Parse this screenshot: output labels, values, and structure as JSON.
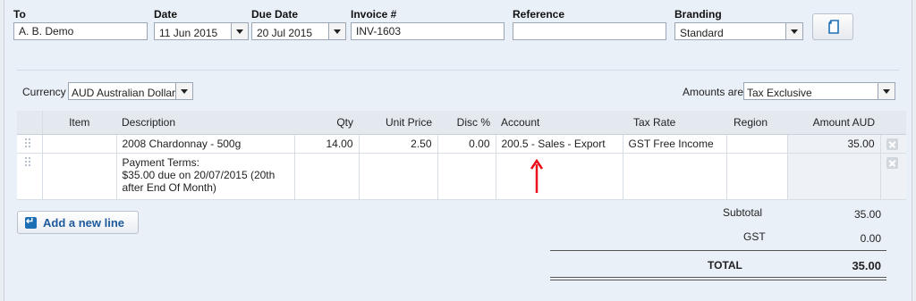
{
  "header": {
    "to": {
      "label": "To",
      "value": "A. B. Demo"
    },
    "date": {
      "label": "Date",
      "value": "11 Jun 2015"
    },
    "due_date": {
      "label": "Due Date",
      "value": "20 Jul 2015"
    },
    "invoice_no": {
      "label": "Invoice #",
      "value": "INV-1603"
    },
    "reference": {
      "label": "Reference",
      "value": ""
    },
    "branding": {
      "label": "Branding",
      "value": "Standard"
    }
  },
  "options": {
    "currency_label": "Currency",
    "currency_value": "AUD Australian Dollar",
    "amounts_label": "Amounts are",
    "amounts_value": "Tax Exclusive"
  },
  "table": {
    "columns": [
      "Item",
      "Description",
      "Qty",
      "Unit Price",
      "Disc %",
      "Account",
      "Tax Rate",
      "Region",
      "Amount AUD"
    ],
    "rows": [
      {
        "item": "",
        "description": "2008 Chardonnay - 500g",
        "qty": "14.00",
        "unit_price": "2.50",
        "disc": "0.00",
        "account": "200.5 - Sales - Export",
        "tax_rate": "GST Free Income",
        "region": "",
        "amount": "35.00"
      },
      {
        "item": "",
        "description_lines": [
          "Payment Terms:",
          "$35.00 due on 20/07/2015 (20th",
          "after End Of Month)"
        ],
        "qty": "",
        "unit_price": "",
        "disc": "",
        "account": "",
        "tax_rate": "",
        "region": "",
        "amount": ""
      }
    ]
  },
  "add_line_label": "Add a new line",
  "totals": {
    "subtotal_label": "Subtotal",
    "subtotal": "35.00",
    "gst_label": "GST",
    "gst": "0.00",
    "total_label": "TOTAL",
    "total": "35.00"
  },
  "annotation": {
    "type": "arrow-up",
    "color": "#e8101a"
  },
  "colors": {
    "link": "#1d5a9c",
    "header_bg": "#e4e9f0",
    "frame_bg": "#eaf0f8"
  }
}
